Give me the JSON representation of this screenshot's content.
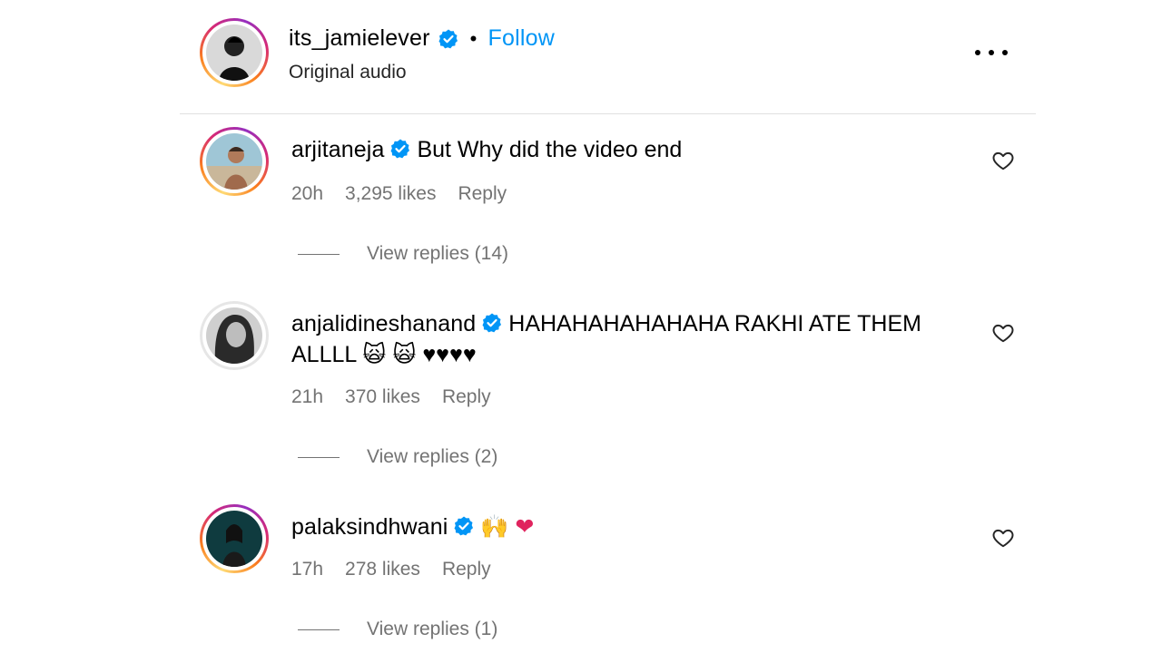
{
  "post_header": {
    "username": "its_jamielever",
    "separator": "•",
    "follow_label": "Follow",
    "subtitle": "Original audio",
    "more_icon": "more-horizontal-icon"
  },
  "comments": [
    {
      "username": "arjitaneja",
      "text": "But Why did the video end",
      "time": "20h",
      "likes": "3,295 likes",
      "reply_label": "Reply",
      "view_replies": "View replies (14)",
      "avatar_style": "story-ring"
    },
    {
      "username": "anjalidineshanand",
      "text": "HAHAHAHAHAHAHA RAKHI ATE THEM ALLLL 🙀 🙀 ♥♥♥♥",
      "time": "21h",
      "likes": "370 likes",
      "reply_label": "Reply",
      "view_replies": "View replies (2)",
      "avatar_style": "plain"
    },
    {
      "username": "palaksindhwani",
      "text": "🙌 ❤",
      "time": "17h",
      "likes": "278 likes",
      "reply_label": "Reply",
      "view_replies": "View replies (1)",
      "avatar_style": "story-ring"
    }
  ],
  "colors": {
    "accent": "#0095f6",
    "muted": "#737373",
    "verified": "#0095f6"
  }
}
